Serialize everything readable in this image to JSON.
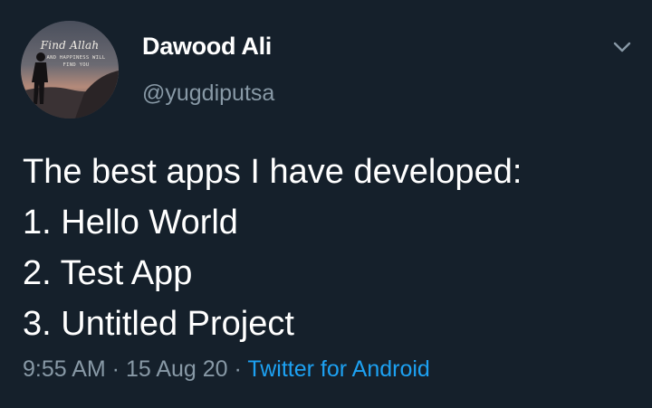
{
  "user": {
    "display_name": "Dawood Ali",
    "handle": "@yugdiputsa",
    "avatar": {
      "icon": "profile-photo-silhouette-sunset",
      "text_line1": "Find Allah",
      "text_line2": "AND HAPPINESS WILL FIND YOU"
    }
  },
  "tweet": {
    "lines": [
      "The best apps I have developed:",
      "1. Hello World",
      "2. Test App",
      "3. Untitled Project"
    ]
  },
  "meta": {
    "time": "9:55 AM",
    "sep1": " · ",
    "date": "15 Aug 20",
    "sep2": " · ",
    "source": "Twitter for Android"
  },
  "colors": {
    "background": "#15202b",
    "primary_text": "#ffffff",
    "secondary_text": "#8899a6",
    "link": "#1da1f2"
  },
  "icons": {
    "menu": "chevron-down-icon"
  }
}
